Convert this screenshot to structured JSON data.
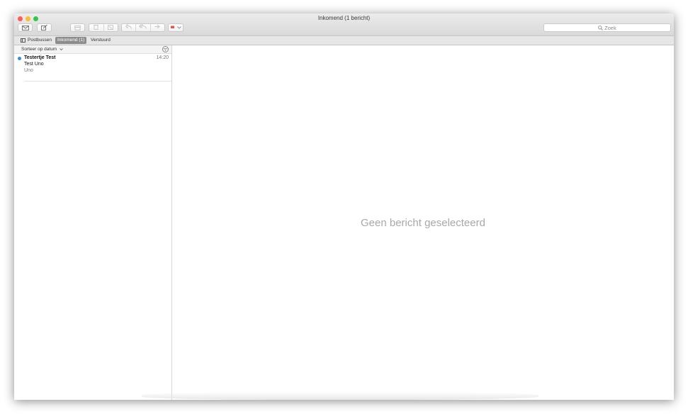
{
  "window": {
    "title": "Inkomend (1 bericht)"
  },
  "toolbar": {
    "get_mail_icon": "envelope-icon",
    "compose_icon": "compose-icon",
    "archive_icon": "archive-icon",
    "trash_icon": "trash-icon",
    "junk_icon": "junk-icon",
    "reply_icon": "reply-icon",
    "reply_all_icon": "reply-all-icon",
    "forward_icon": "forward-icon",
    "flag_icon": "flag-icon",
    "flag_color": "#e2554f"
  },
  "search": {
    "placeholder": "Zoek"
  },
  "favorites": {
    "mailboxes_label": "Postbussen",
    "inbox_label": "Inkomend (1)",
    "sent_label": "Verstuurd"
  },
  "list": {
    "sort_label": "Sorteer op datum",
    "messages": [
      {
        "from": "Testertje Test",
        "time": "14:20",
        "subject": "Test Uno",
        "preview": "Uno",
        "unread": true
      }
    ]
  },
  "viewer": {
    "empty_text": "Geen bericht geselecteerd"
  },
  "colors": {
    "unread_dot": "#3a8bd9",
    "close": "#fc5b57",
    "minimize": "#fdbc2e",
    "maximize": "#33c748"
  }
}
